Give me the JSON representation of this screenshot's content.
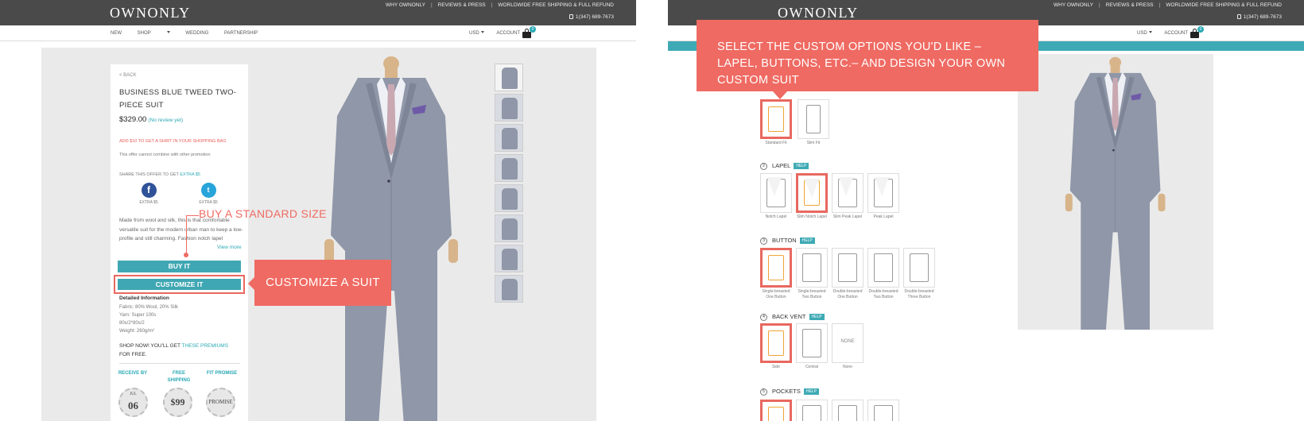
{
  "header": {
    "logo": "OWNONLY",
    "links": [
      "WHY OWNONLY",
      "REVIEWS & PRESS",
      "WORLDWIDE FREE SHIPPING & FULL REFUND"
    ],
    "phone": "1(347) 689-7673"
  },
  "nav": {
    "items": [
      "NEW",
      "SHOP",
      "WEDDING",
      "PARTNERSHIP"
    ],
    "currency": "USD",
    "account": "ACCOUNT",
    "cart_count": "0"
  },
  "product": {
    "back": "< BACK",
    "title": "BUSINESS BLUE TWEED TWO-PIECE SUIT",
    "price": "$329.00",
    "review": "(No review yet)",
    "promo": "ADD $10 TO GET A SHIRT IN YOUR SHOPPING BAG",
    "promo_note": "This offer cannot combine with other promotion",
    "share_prefix": "SHARE THIS OFFER TO GET ",
    "share_highlight": "EXTRA $5",
    "facebook_label": "EXTRA $5",
    "twitter_label": "EXTRA $5",
    "description": "Made from wool and silk, this is that comfortable versatile suit for the modern urban man to keep a low-profile and still charming. Fashion notch lapel",
    "view_more": "View more",
    "buy_label": "BUY IT",
    "customize_label": "CUSTOMIZE IT",
    "details_title": "Detailed Information",
    "details": [
      "Fabric: 80% Wool, 20% Silk",
      "Yarn: Super 100s",
      "80s/2*80s/2",
      "Weight: 260g/m²"
    ],
    "shopnow_prefix": "SHOP NOW! YOU'LL GET ",
    "shopnow_highlight": "THESE PREMIUMS",
    "shopnow_suffix": " FOR FREE.",
    "perks": [
      {
        "label": "RECEIVE BY",
        "badge_top": "JUL",
        "badge_main": "06"
      },
      {
        "label": "FREE SHIPPING",
        "badge_main": "$99"
      },
      {
        "label": "FIT PROMISE",
        "badge_main": "PROMISE"
      }
    ]
  },
  "annotations": {
    "buy_standard": "BUY A STANDARD SIZE",
    "customize": "CUSTOMIZE A SUIT",
    "custom_options": "SELECT THE CUSTOM OPTIONS YOU'D LIKE – LAPEL, BUTTONS, ETC.– AND DESIGN YOUR OWN CUSTOM SUIT"
  },
  "customizer": {
    "fit": {
      "options": [
        "Standard Fit",
        "Slim Fit"
      ],
      "selected": 0
    },
    "lapel": {
      "num": "2",
      "title": "LAPEL",
      "help": "HELP",
      "options": [
        "Notch Lapel",
        "Slim Notch Lapel",
        "Slim Peak Lapel",
        "Peak Lapel"
      ],
      "selected": 1
    },
    "button": {
      "num": "3",
      "title": "BUTTON",
      "help": "HELP",
      "options": [
        "Single-breasted One Button",
        "Single-breasted Two Button",
        "Double-breasted One Button",
        "Double-breasted Two Button",
        "Double-breasted Three Button"
      ],
      "selected": 0
    },
    "vent": {
      "num": "4",
      "title": "BACK VENT",
      "help": "HELP",
      "options": [
        "Side",
        "Central",
        "None"
      ],
      "none_text": "NONE",
      "selected": 0
    },
    "pockets": {
      "num": "5",
      "title": "POCKETS",
      "help": "HELP"
    }
  },
  "colors": {
    "accent": "#3eaab5",
    "callout": "#ef6a62",
    "header": "#4a4a4a",
    "suit": "#8f97a8"
  }
}
